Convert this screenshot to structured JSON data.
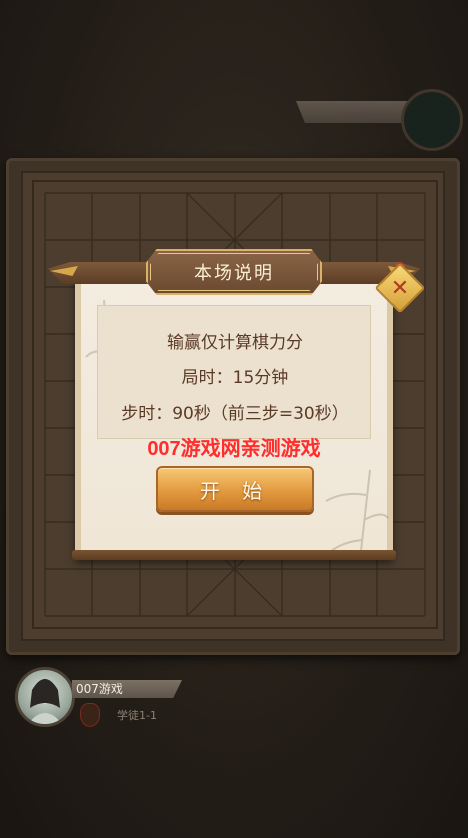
{
  "dialog": {
    "title": "本场说明",
    "rules": {
      "line1": "输赢仅计算棋力分",
      "line2": "局时：15分钟",
      "line3": "步时：90秒（前三步=30秒）"
    },
    "watermark": "007游戏网亲测游戏",
    "start_label": "开 始",
    "close_symbol": "✕"
  },
  "player": {
    "name": "007游戏",
    "rank": "学徒1-1"
  },
  "colors": {
    "board": "#5a4837",
    "dialog_bg": "#efe6d6",
    "button": "#e39a3e",
    "watermark": "#ff2d2d"
  }
}
